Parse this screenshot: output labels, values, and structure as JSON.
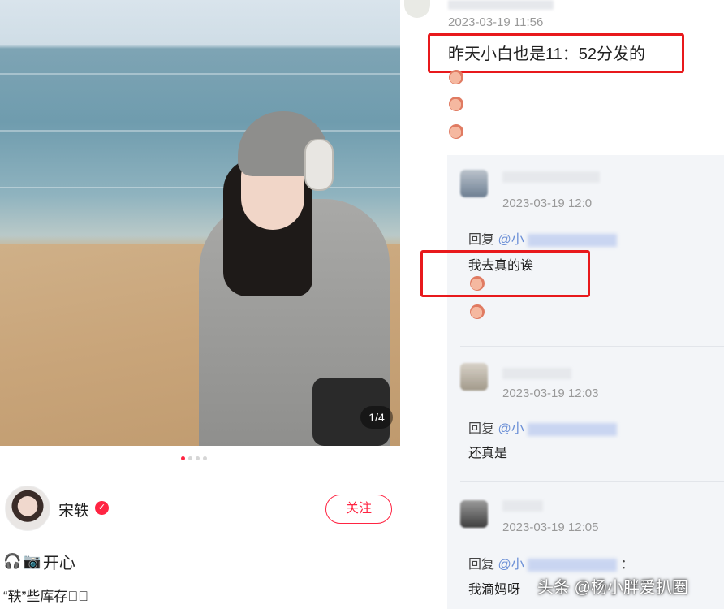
{
  "post": {
    "image_counter": "1/4",
    "carousel": {
      "total": 4,
      "active_index": 0
    },
    "author": {
      "name": "宋轶",
      "verified_icon": "verified-check-icon"
    },
    "follow_label": "关注",
    "status_icons": [
      "headphones-icon",
      "camera-icon"
    ],
    "status_text": "开心",
    "description": "“轶”些库存􀀀􀀀"
  },
  "comment": {
    "time": "2023-03-19 11:56",
    "text": "昨天小白也是11：52分发的"
  },
  "replies": [
    {
      "time": "2023-03-19 12:0",
      "prefix": "回复",
      "at": "@小",
      "text": "我去真的诶"
    },
    {
      "time": "2023-03-19 12:03",
      "prefix": "回复",
      "at": "@小",
      "text": "还真是"
    },
    {
      "time": "2023-03-19 12:05",
      "prefix": "回复",
      "at": "@小",
      "suffix": "：",
      "text": "我滴妈呀"
    }
  ],
  "watermark": "头条 @杨小胖爱扒圈",
  "colors": {
    "accent": "#ff2442",
    "highlight_box": "#e8191c",
    "panel_bg": "#f3f5f8"
  }
}
